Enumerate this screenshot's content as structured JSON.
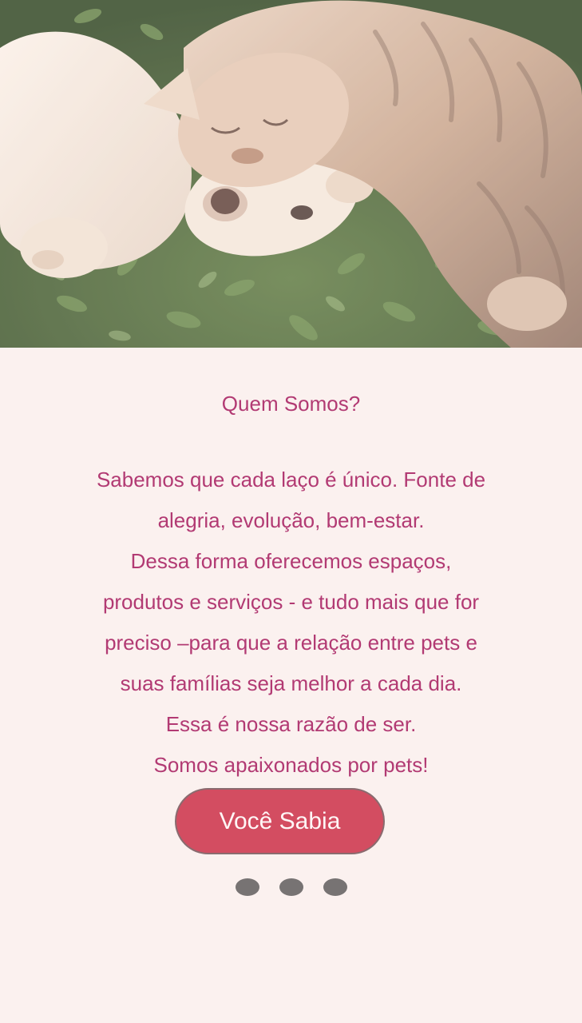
{
  "hero": {
    "image": "dog-and-cat-lying-on-grass-photo"
  },
  "about": {
    "title": "Quem Somos?",
    "lines": [
      "Sabemos que cada laço é único. Fonte de",
      "alegria, evolução, bem-estar.",
      "Dessa forma oferecemos espaços,",
      "produtos e serviços - e tudo mais que for",
      "preciso –para que a relação entre pets e",
      "suas famílias seja melhor a cada dia.",
      "Essa é nossa razão de ser.",
      "Somos apaixonados por pets!"
    ]
  },
  "cta": {
    "label": "Você Sabia"
  },
  "pager": {
    "count": 3
  },
  "colors": {
    "background": "#fbf1ef",
    "text": "#b23a73",
    "button": "#d34d61",
    "dot": "#777373"
  }
}
